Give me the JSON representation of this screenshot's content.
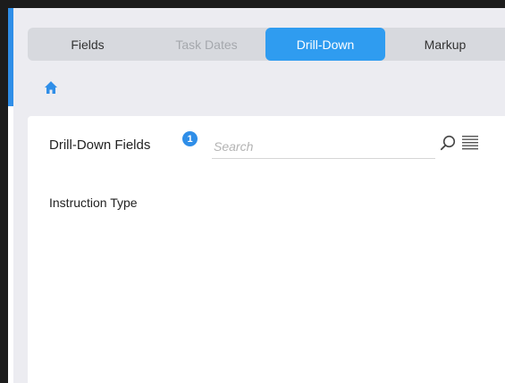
{
  "tabs": [
    {
      "label": "Fields",
      "state": "normal"
    },
    {
      "label": "Task Dates",
      "state": "disabled"
    },
    {
      "label": "Drill-Down",
      "state": "active"
    },
    {
      "label": "Markup",
      "state": "normal"
    }
  ],
  "breadcrumb": {
    "home_icon": "home-icon"
  },
  "panel": {
    "title": "Drill-Down Fields",
    "badge_count": "1",
    "search": {
      "placeholder": "Search",
      "value": ""
    },
    "icons": {
      "search": "search-icon",
      "list_view": "list-view-icon"
    },
    "items": [
      {
        "label": "Instruction Type"
      }
    ]
  },
  "colors": {
    "accent": "#2f9cf0",
    "badge": "#2f8ee8",
    "tabbar_bg": "#d7d9de",
    "panel_bg": "#ececf1"
  }
}
